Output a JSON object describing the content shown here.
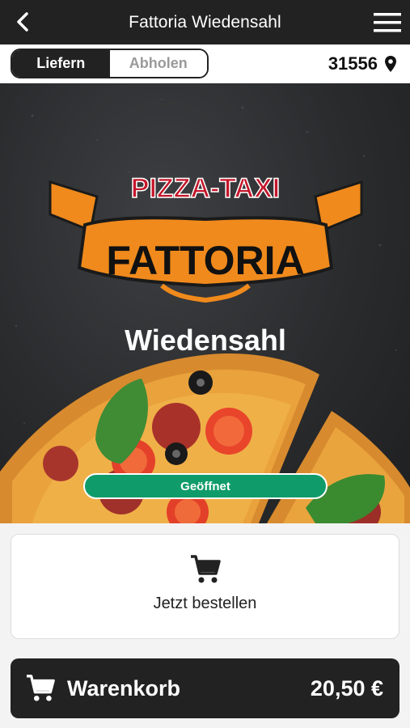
{
  "header": {
    "title": "Fattoria Wiedensahl",
    "back_icon": "chevron-left-icon",
    "menu_icon": "hamburger-menu-icon"
  },
  "mode_toggle": {
    "options": [
      "Liefern",
      "Abholen"
    ],
    "selected": "Liefern"
  },
  "location": {
    "zip": "31556",
    "icon": "map-pin-icon"
  },
  "hero": {
    "logo_top": "PIZZA-TAXI",
    "logo_main": "FATTORIA",
    "logo_sub": "Wiedensahl",
    "status": "Geöffnet"
  },
  "order_card": {
    "label": "Jetzt bestellen",
    "icon": "cart-icon"
  },
  "cart": {
    "label": "Warenkorb",
    "total": "20,50 €",
    "icon": "cart-icon"
  },
  "colors": {
    "dark": "#222222",
    "accent_orange": "#f08a1c",
    "logo_red": "#c4162a",
    "open_green": "#0f9c6a"
  }
}
